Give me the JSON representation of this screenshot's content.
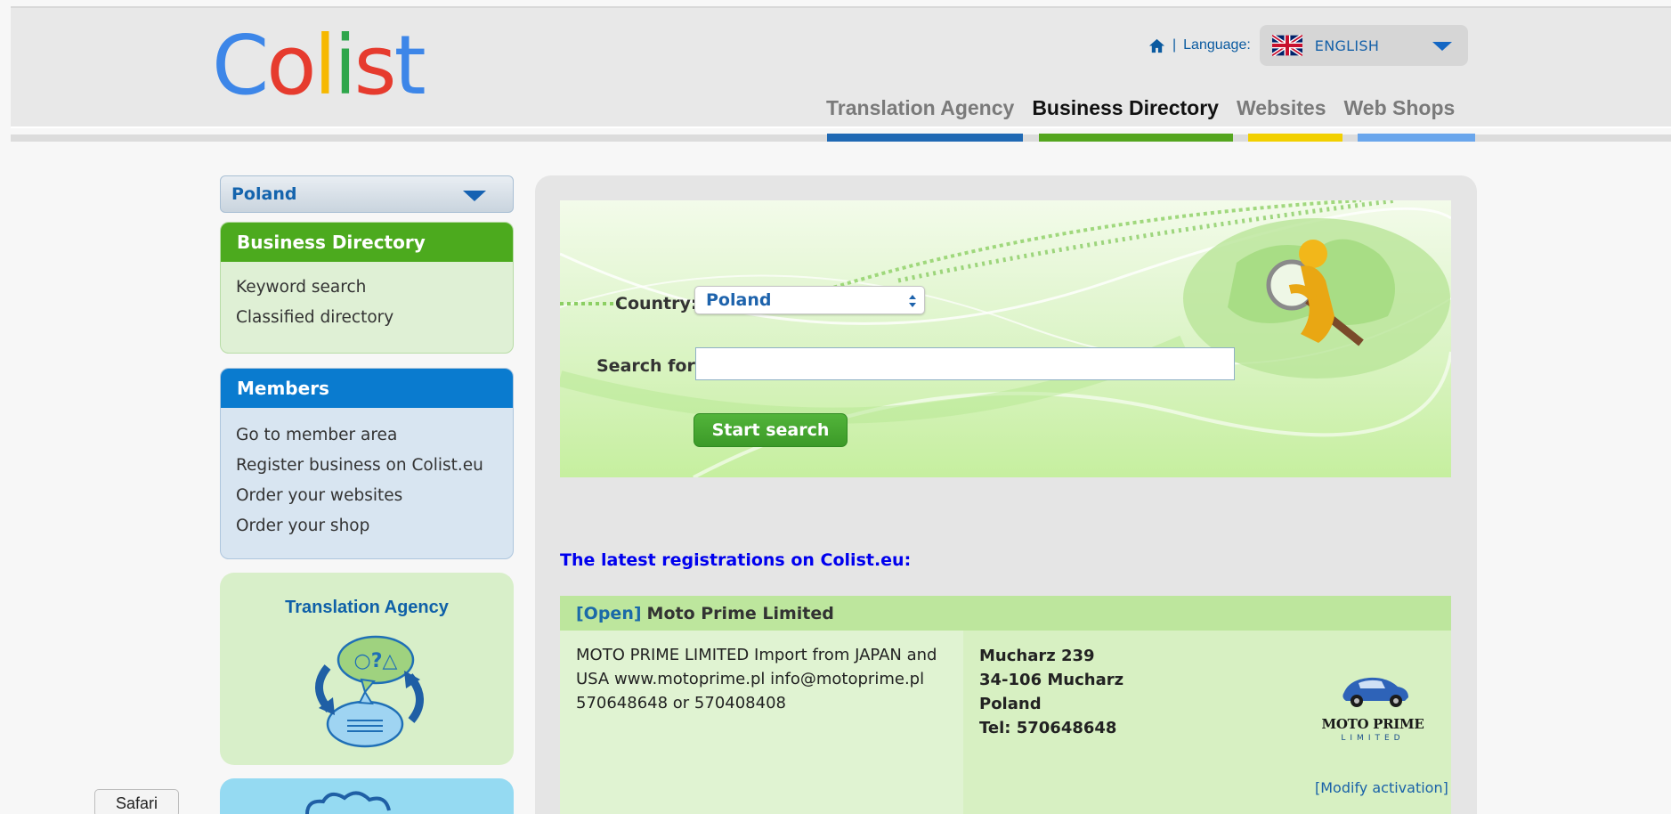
{
  "header": {
    "logo": [
      "C",
      "o",
      "l",
      "i",
      "s",
      "t"
    ],
    "logo_colors": [
      "#3d86e8",
      "#e63b2e",
      "#f6b800",
      "#2ea64b",
      "#e63b2e",
      "#3d86e8"
    ],
    "language_label": "Language:",
    "language_value": "ENGLISH",
    "nav": [
      {
        "label": "Translation Agency",
        "color": "#1f69b4"
      },
      {
        "label": "Business Directory",
        "color": "#55a61f"
      },
      {
        "label": "Websites",
        "color": "#f2d000"
      },
      {
        "label": "Web Shops",
        "color": "#6aa6ec"
      }
    ]
  },
  "sidebar": {
    "country_select": "Poland",
    "business_directory": {
      "title": "Business Directory",
      "links": [
        "Keyword search",
        "Classified directory"
      ]
    },
    "members": {
      "title": "Members",
      "links": [
        "Go to member area",
        "Register business on Colist.eu",
        "Order your websites",
        "Order your shop"
      ]
    },
    "translation_agency": {
      "title": "Translation Agency",
      "icon": "translation-icon"
    }
  },
  "search": {
    "country_label": "Country:",
    "country_value": "Poland",
    "search_label": "Search for:",
    "search_value": "",
    "button": "Start search"
  },
  "latest": {
    "title": "The latest registrations on Colist.eu:",
    "entry": {
      "status": "[Open]",
      "name": "Moto Prime Limited",
      "description": "MOTO PRIME LIMITED Import from JAPAN and USA www.motoprime.pl info@motoprime.pl 570648648 or 570408408",
      "address": [
        "Mucharz 239",
        "34-106 Mucharz",
        "Poland",
        "Tel: 570648648"
      ],
      "logo_name": "MOTO PRIME",
      "logo_sub": "LIMITED",
      "modify": "[Modify activation]"
    }
  },
  "tooltip": "Safari"
}
